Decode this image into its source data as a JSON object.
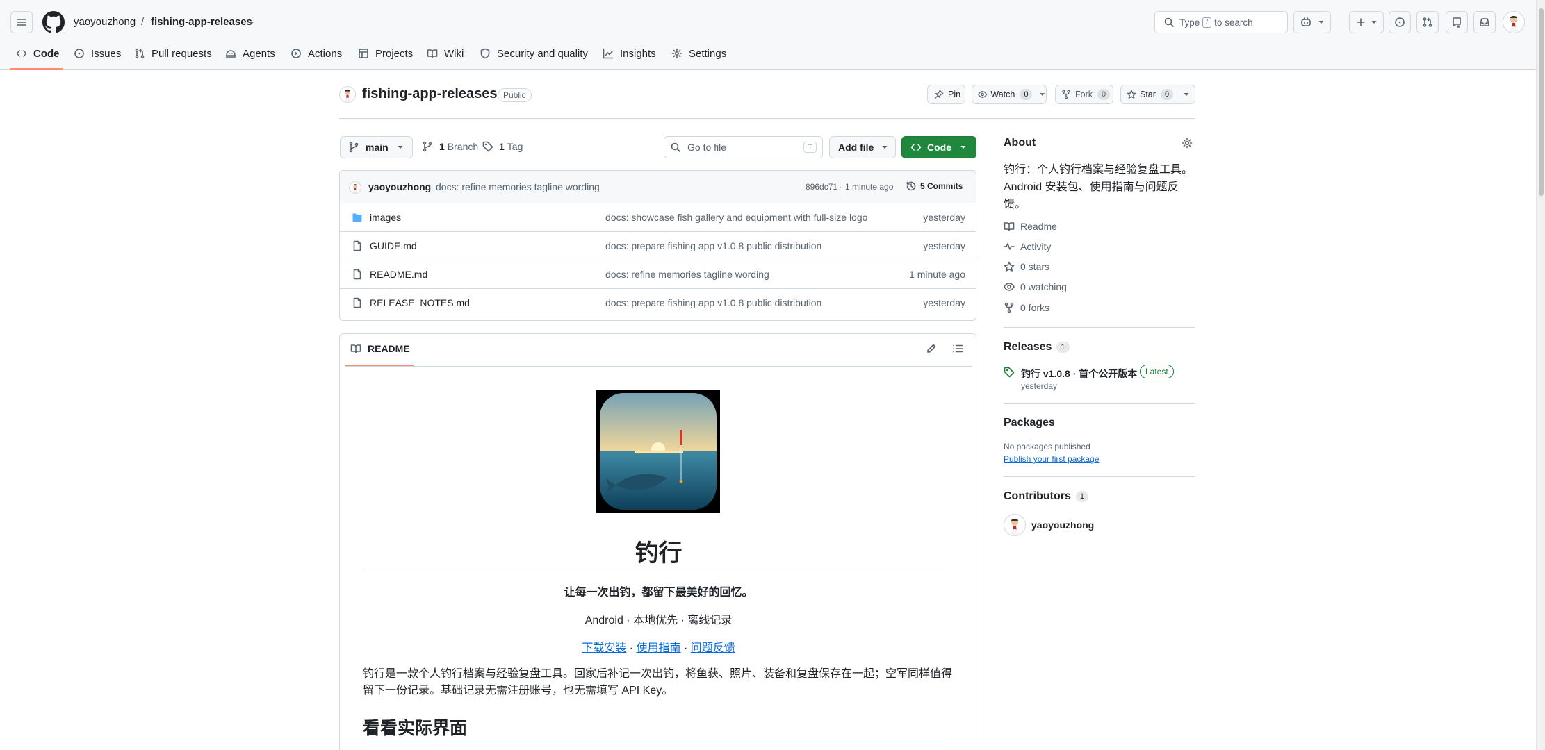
{
  "header": {
    "owner": "yaoyouzhong",
    "separator": "/",
    "repo": "fishing-app-releases",
    "search_prefix": "Type",
    "search_key": "/",
    "search_suffix": "to search"
  },
  "tabs": [
    {
      "label": "Code",
      "icon": "code-icon"
    },
    {
      "label": "Issues",
      "icon": "issue-icon"
    },
    {
      "label": "Pull requests",
      "icon": "pull-request-icon"
    },
    {
      "label": "Agents",
      "icon": "agents-icon"
    },
    {
      "label": "Actions",
      "icon": "play-icon"
    },
    {
      "label": "Projects",
      "icon": "table-icon"
    },
    {
      "label": "Wiki",
      "icon": "book-icon"
    },
    {
      "label": "Security and quality",
      "icon": "shield-icon"
    },
    {
      "label": "Insights",
      "icon": "graph-icon"
    },
    {
      "label": "Settings",
      "icon": "gear-icon"
    }
  ],
  "repo_header": {
    "name": "fishing-app-releases",
    "visibility": "Public",
    "pin": "Pin",
    "watch": "Watch",
    "watch_count": "0",
    "fork": "Fork",
    "fork_count": "0",
    "star": "Star",
    "star_count": "0"
  },
  "toolbar": {
    "branch": "main",
    "branches_count": "1",
    "branches_label": "Branch",
    "tags_count": "1",
    "tags_label": "Tag",
    "goto_placeholder": "Go to file",
    "goto_key": "T",
    "add_file": "Add file",
    "code": "Code"
  },
  "commit": {
    "author": "yaoyouzhong",
    "message": "docs: refine memories tagline wording",
    "sha": "896dc71",
    "dot": "·",
    "time": "1 minute ago",
    "count": "5 Commits"
  },
  "files": [
    {
      "name": "images",
      "type": "folder",
      "message": "docs: showcase fish gallery and equipment with full-size logo",
      "time": "yesterday"
    },
    {
      "name": "GUIDE.md",
      "type": "file",
      "message": "docs: prepare fishing app v1.0.8 public distribution",
      "time": "yesterday"
    },
    {
      "name": "README.md",
      "type": "file",
      "message": "docs: refine memories tagline wording",
      "time": "1 minute ago"
    },
    {
      "name": "RELEASE_NOTES.md",
      "type": "file",
      "message": "docs: prepare fishing app v1.0.8 public distribution",
      "time": "yesterday"
    }
  ],
  "readme": {
    "tab": "README",
    "title": "钓行",
    "tagline": "让每一次出钓，都留下最美好的回忆。",
    "platform": "Android · 本地优先 · 离线记录",
    "links": [
      "下载安装",
      "使用指南",
      "问题反馈"
    ],
    "link_sep": "·",
    "description": "钓行是一款个人钓行档案与经验复盘工具。回家后补记一次出钓，将鱼获、照片、装备和复盘保存在一起；空军同样值得留下一份记录。基础记录无需注册账号，也无需填写 API Key。",
    "section": "看看实际界面"
  },
  "about": {
    "heading": "About",
    "description": "钓行：个人钓行档案与经验复盘工具。Android 安装包、使用指南与问题反馈。",
    "items": [
      {
        "label": "Readme",
        "icon": "book-icon"
      },
      {
        "label": "Activity",
        "icon": "pulse-icon"
      },
      {
        "label": "0 stars",
        "icon": "star-icon"
      },
      {
        "label": "0 watching",
        "icon": "eye-icon"
      },
      {
        "label": "0 forks",
        "icon": "fork-icon"
      }
    ]
  },
  "releases": {
    "heading": "Releases",
    "count": "1",
    "name": "钓行 v1.0.8 · 首个公开版本",
    "badge": "Latest",
    "time": "yesterday"
  },
  "packages": {
    "heading": "Packages",
    "empty": "No packages published",
    "link": "Publish your first package"
  },
  "contributors": {
    "heading": "Contributors",
    "count": "1",
    "name": "yaoyouzhong"
  },
  "colors": {
    "accent": "#0969da",
    "code_button": "#1f883d",
    "tab_underline": "#fd8c73",
    "latest_badge": "#1a7f37"
  }
}
